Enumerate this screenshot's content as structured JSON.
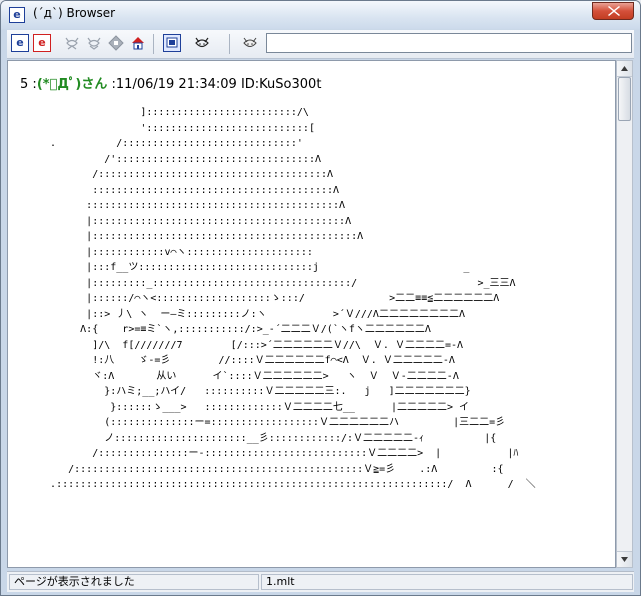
{
  "window": {
    "app_icon_letter": "e",
    "title": "(´д`) Browser"
  },
  "toolbar": {
    "address_value": ""
  },
  "post": {
    "number": "5",
    "sep": ":",
    "name": "(*ﾟДﾟ)さん",
    "sep2": ":",
    "date": "11/06/19 21:34:09",
    "id": "ID:KuSo300t"
  },
  "aa_text": "                  ]:::::::::::::::::::::::::/\\\n                  ':::::::::::::::::::::::::::[\n   .          /:::::::::::::::::::::::::::::'\n            /':::::::::::::::::::::::::::::::::Λ\n          /::::::::::::::::::::::::::::::::::::::Λ\n          ::::::::::::::::::::::::::::::::::::::::Λ\n         ::::::::::::::::::::::::::::::::::::::::::Λ\n         |::::::::::::::::::::::::::::::::::::::::::Λ\n         |::::::::::::::::::::::::::::::::::::::::::::Λ\n         |::::::::::::v⌒ヽ:::::::::::::::::::::\n         |:::f__ツ:::::::::::::::::::::::::::::j                        _\n         |:::::::::_:::::::::::::::::::::::::::::::::/                    >_三三Λ\n         |::::::/⌒ヽ<:::::::::::::::::::ゝ:::/              >二二≡≡≦二二二二二二Λ\n         |::> 丿\\ ヽ  ー―ミ:::::::::ノ:ヽ           >´Ｖ///Λ二二二二二二二二Λ\n        Λ:{    r>=≡ミ`ヽ,:::::::::::/:>_-´二二二Ｖ/(`ヽfヽ二二二二二二Λ\n          ]/\\  f[///////7        [/:::>´二二二二二二Ｖ//\\  Ｖ. Ｖ二二二二=-Λ\n          !:八    ゞ-=彡        //::::Ｖ二二二二二二f⌒<Λ  Ｖ. Ｖ二二二二二-Λ\n          ヾ:Λ       从い      イ`::::Ｖ二二二二二二>   ヽ  Ｖ  Ｖ-二二二二-Λ\n            }:ハミ;__;ハイ/   ::::::::::Ｖ二二二二二三:.   j   ]二二二二二二二}\n             }::::::ゝ___>   :::::::::::::Ｖ二二二二七__      |二二二二二> イ\n            (::::::::::::::ー=::::::::::::::::::Ｖ二二二二二二ハ         |三二二=彡\n            ノ::::::::::::::::::::::__彡::::::::::::/:Ｖ二二二二二-ｨ          |{\n          /:::::::::::::::ー-:::::::::::::::::::::::::::Ｖ二二二二>  |           |ﾊ\n      /::::::::::::::::::::::::::::::::::::::::::::::::Ｖ≧=彡    .:Λ         :{\n   .:::::::::::::::::::::::::::::::::::::::::::::::::::::::::::::::::/  Λ      /  ＼",
  "status": {
    "message": "ページが表示されました",
    "file": "1.mlt"
  },
  "colors": {
    "post_name": "#228b22",
    "title_gradient_top": "#f4f8fc",
    "close_button": "#c23d22",
    "toolbar_icon_blue": "#1e3f99",
    "toolbar_icon_red": "#d02020"
  },
  "icons": [
    "app-e-icon",
    "blue-e-icon",
    "red-e-icon",
    "cat-back-icon",
    "cat-forward-icon",
    "stop-icon",
    "home-icon",
    "bbs-icon",
    "cat-face-icon",
    "cat-search-icon",
    "close-icon",
    "scroll-up-icon",
    "scroll-down-icon"
  ]
}
